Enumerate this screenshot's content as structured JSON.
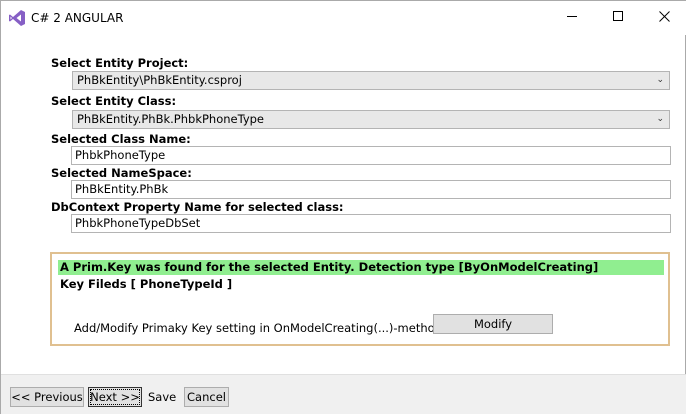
{
  "window": {
    "title": "C# 2 ANGULAR",
    "icons": {
      "app": "visual-studio-icon",
      "minimize": "minimize-icon",
      "maximize": "maximize-icon",
      "close": "close-icon"
    }
  },
  "form": {
    "entity_project": {
      "label": "Select Entity Project:",
      "value": "PhBkEntity\\PhBkEntity.csproj"
    },
    "entity_class": {
      "label": "Select Entity Class:",
      "value": "PhBkEntity.PhBk.PhbkPhoneType"
    },
    "class_name": {
      "label": "Selected Class Name:",
      "value": "PhbkPhoneType"
    },
    "namespace": {
      "label": "Selected NameSpace:",
      "value": "PhBkEntity.PhBk"
    },
    "dbcontext_property": {
      "label": "DbContext Property Name for selected class:",
      "value": "PhbkPhoneTypeDbSet"
    }
  },
  "primary_key": {
    "found_message": "A Prim.Key was found for the selected Entity. Detection type [ByOnModelCreating]",
    "key_fields": "Key Fileds [ PhoneTypeId ]",
    "hint": "Add/Modify Primaky Key setting in OnModelCreating(...)-method",
    "modify_label": "Modify"
  },
  "footer": {
    "previous_label": "<< Previous",
    "next_label": "Next >>",
    "save_label": "Save",
    "cancel_label": "Cancel"
  },
  "colors": {
    "found_highlight": "#90ee90",
    "panel_border": "#e0c090",
    "vs_purple": "#865fc5"
  }
}
